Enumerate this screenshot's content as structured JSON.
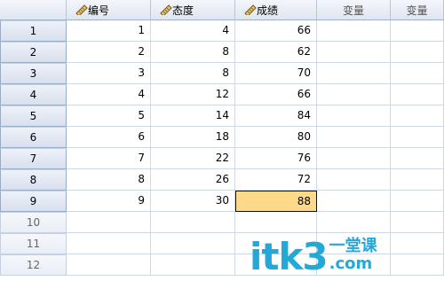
{
  "columns": [
    {
      "label": "编号",
      "type": "variable"
    },
    {
      "label": "态度",
      "type": "variable"
    },
    {
      "label": "成绩",
      "type": "variable"
    },
    {
      "label": "变量",
      "type": "empty"
    },
    {
      "label": "变量",
      "type": "empty"
    }
  ],
  "rows": [
    {
      "num": "1",
      "cells": [
        "1",
        "4",
        "66"
      ]
    },
    {
      "num": "2",
      "cells": [
        "2",
        "8",
        "62"
      ]
    },
    {
      "num": "3",
      "cells": [
        "3",
        "8",
        "70"
      ]
    },
    {
      "num": "4",
      "cells": [
        "4",
        "12",
        "66"
      ]
    },
    {
      "num": "5",
      "cells": [
        "5",
        "14",
        "84"
      ]
    },
    {
      "num": "6",
      "cells": [
        "6",
        "18",
        "80"
      ]
    },
    {
      "num": "7",
      "cells": [
        "7",
        "22",
        "76"
      ]
    },
    {
      "num": "8",
      "cells": [
        "8",
        "26",
        "72"
      ]
    },
    {
      "num": "9",
      "cells": [
        "9",
        "30",
        "88"
      ]
    },
    {
      "num": "10",
      "cells": [
        "",
        "",
        ""
      ]
    },
    {
      "num": "11",
      "cells": [
        "",
        "",
        ""
      ]
    },
    {
      "num": "12",
      "cells": [
        "",
        "",
        ""
      ]
    }
  ],
  "selected_cell": {
    "row": 9,
    "column": "成绩"
  },
  "watermark": {
    "main": "itk3",
    "cn": "一堂课",
    "com": ".com"
  },
  "colors": {
    "selected": "#ffd98a",
    "watermark": "#23a8d8"
  }
}
